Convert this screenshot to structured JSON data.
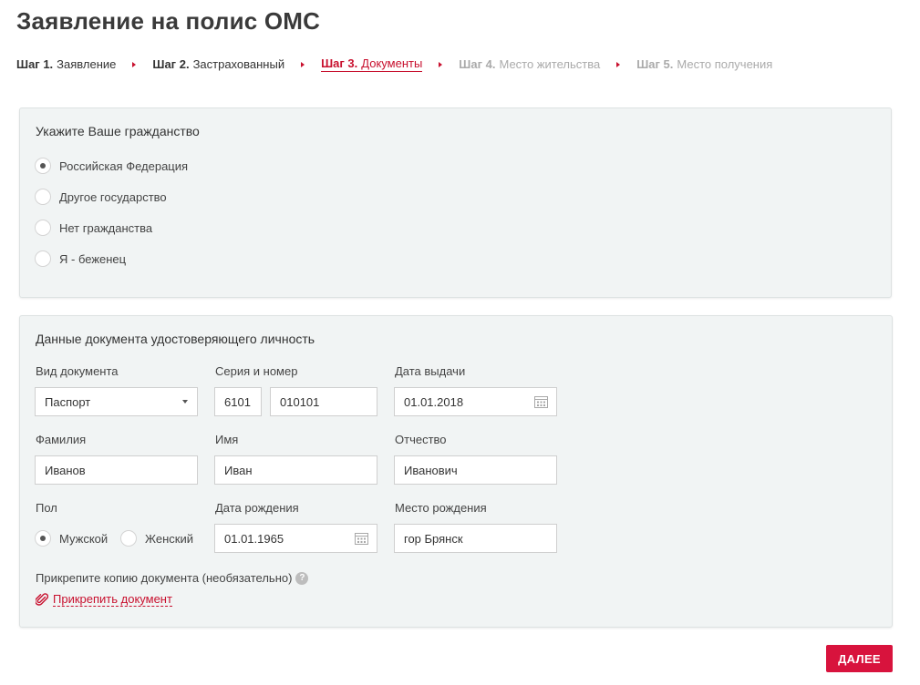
{
  "page": {
    "title": "Заявление на полис ОМС"
  },
  "steps": [
    {
      "prefix": "Шаг 1.",
      "label": "Заявление",
      "state": "done"
    },
    {
      "prefix": "Шаг 2.",
      "label": "Застрахованный",
      "state": "done"
    },
    {
      "prefix": "Шаг 3.",
      "label": "Документы",
      "state": "active"
    },
    {
      "prefix": "Шаг 4.",
      "label": "Место жительства",
      "state": "disabled"
    },
    {
      "prefix": "Шаг 5.",
      "label": "Место получения",
      "state": "disabled"
    }
  ],
  "citizenship": {
    "title": "Укажите Ваше гражданство",
    "options": [
      {
        "label": "Российская Федерация",
        "checked": true
      },
      {
        "label": "Другое государство",
        "checked": false
      },
      {
        "label": "Нет гражданства",
        "checked": false
      },
      {
        "label": "Я - беженец",
        "checked": false
      }
    ]
  },
  "document": {
    "title": "Данные документа удостоверяющего личность",
    "doc_type_label": "Вид документа",
    "doc_type_value": "Паспорт",
    "series_number_label": "Серия и номер",
    "series_value": "6101",
    "number_value": "010101",
    "issue_date_label": "Дата выдачи",
    "issue_date_value": "01.01.2018",
    "last_name_label": "Фамилия",
    "last_name_value": "Иванов",
    "first_name_label": "Имя",
    "first_name_value": "Иван",
    "patronymic_label": "Отчество",
    "patronymic_value": "Иванович",
    "gender_label": "Пол",
    "gender_male": "Мужской",
    "gender_female": "Женский",
    "gender_selected": "male",
    "birth_date_label": "Дата рождения",
    "birth_date_value": "01.01.1965",
    "birth_place_label": "Место рождения",
    "birth_place_value": "гор Брянск",
    "attach_label": "Прикрепите копию документа (необязательно)",
    "attach_link": "Прикрепить документ",
    "help_glyph": "?"
  },
  "actions": {
    "next_label": "ДАЛЕЕ"
  },
  "colors": {
    "accent": "#c8102e",
    "button": "#d8133d",
    "panel_bg": "#f1f4f4",
    "disabled_text": "#aaaaaa"
  }
}
